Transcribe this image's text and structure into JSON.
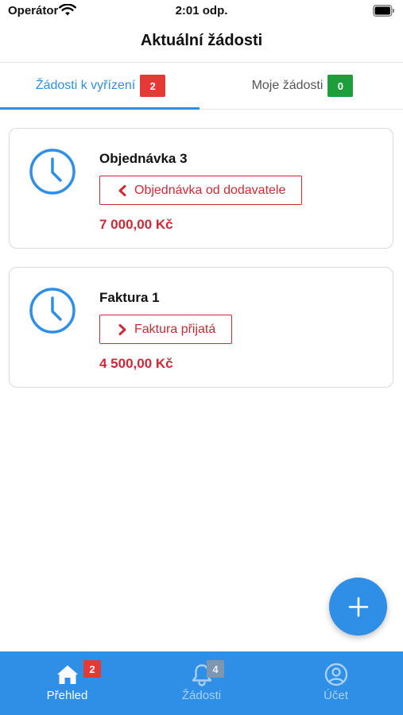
{
  "status_bar": {
    "carrier": "Operátor",
    "time": "2:01 odp."
  },
  "header": {
    "title": "Aktuální žádosti"
  },
  "tabs": [
    {
      "label": "Žádosti k vyřízení",
      "count": "2",
      "active": true
    },
    {
      "label": "Moje žádosti",
      "count": "0",
      "active": false
    }
  ],
  "requests": [
    {
      "title": "Objednávka 3",
      "tag": "Objednávka od dodavatele",
      "tag_icon": "chevron-left-icon",
      "amount": "7 000,00 Kč",
      "icon": "clock-icon"
    },
    {
      "title": "Faktura 1",
      "tag": "Faktura přijatá",
      "tag_icon": "chevron-right-icon",
      "amount": "4 500,00 Kč",
      "icon": "clock-icon"
    }
  ],
  "fab": {
    "icon": "plus-icon"
  },
  "bottom_nav": [
    {
      "label": "Přehled",
      "icon": "home-icon",
      "badge": "2",
      "active": true
    },
    {
      "label": "Žádosti",
      "icon": "bell-icon",
      "badge": "4",
      "active": false
    },
    {
      "label": "Účet",
      "icon": "user-icon",
      "active": false
    }
  ],
  "colors": {
    "accent": "#2f8fe6",
    "danger": "#cc2a36",
    "badge_red": "#e53935",
    "badge_green": "#1e9e3a"
  }
}
